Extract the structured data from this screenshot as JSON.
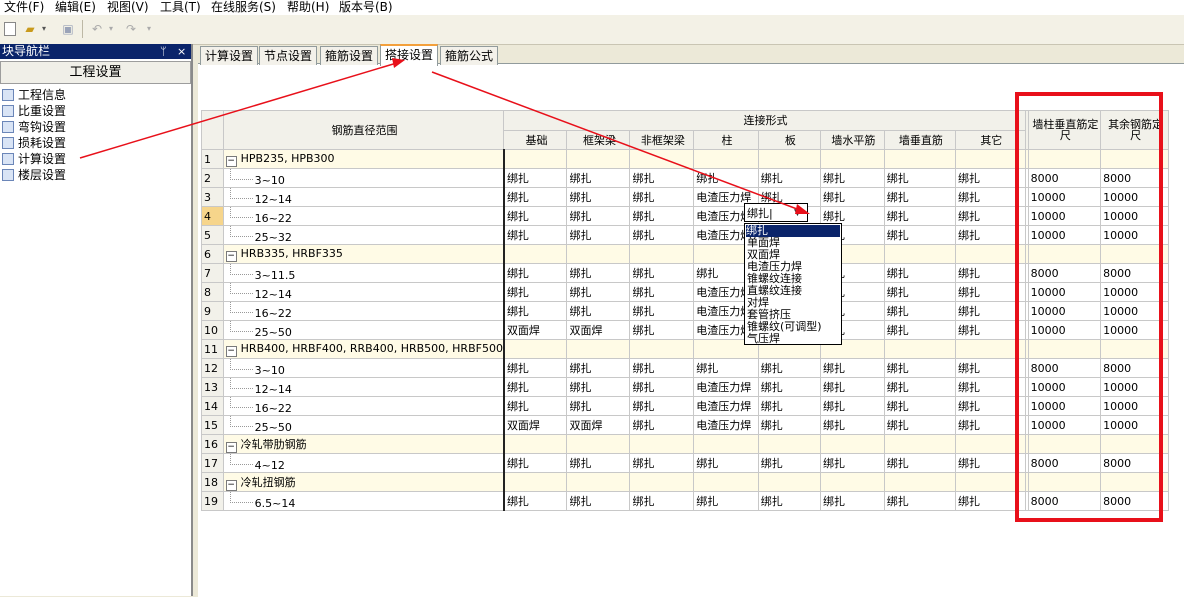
{
  "menu": [
    "文件(F)",
    "编辑(E)",
    "视图(V)",
    "工具(T)",
    "在线服务(S)",
    "帮助(H)",
    "版本号(B)"
  ],
  "toolbar_icons": [
    "new-icon",
    "open-icon",
    "save-icon",
    "undo-icon",
    "redo-icon"
  ],
  "panel": {
    "title": "块导航栏",
    "pin": "ᛘ",
    "close": "×",
    "header": "工程设置",
    "items": [
      "工程信息",
      "比重设置",
      "弯钩设置",
      "损耗设置",
      "计算设置",
      "楼层设置"
    ]
  },
  "tabs": [
    "计算设置",
    "节点设置",
    "箍筋设置",
    "搭接设置",
    "箍筋公式"
  ],
  "active_tab": "搭接设置",
  "grid": {
    "range_header": "钢筋直径范围",
    "group_header": "连接形式",
    "columns": [
      "基础",
      "框架梁",
      "非框架梁",
      "柱",
      "板",
      "墙水平筋",
      "墙垂直筋",
      "其它"
    ],
    "extra_columns": [
      "墙柱垂直筋定尺",
      "其余钢筋定尺"
    ],
    "rows": [
      {
        "num": "1",
        "label": "HPB235, HPB300",
        "group": true
      },
      {
        "num": "2",
        "label": "3~10",
        "cells": [
          "绑扎",
          "绑扎",
          "绑扎",
          "绑扎",
          "绑扎",
          "绑扎",
          "绑扎",
          "绑扎"
        ],
        "ext": [
          "8000",
          "8000"
        ]
      },
      {
        "num": "3",
        "label": "12~14",
        "cells": [
          "绑扎",
          "绑扎",
          "绑扎",
          "电渣压力焊",
          "绑扎",
          "绑扎",
          "绑扎",
          "绑扎"
        ],
        "ext": [
          "10000",
          "10000"
        ]
      },
      {
        "num": "4",
        "label": "16~22",
        "cells": [
          "绑扎",
          "绑扎",
          "绑扎",
          "电渣压力焊",
          "",
          "绑扎",
          "绑扎",
          "绑扎"
        ],
        "ext": [
          "10000",
          "10000"
        ]
      },
      {
        "num": "5",
        "label": "25~32",
        "cells": [
          "绑扎",
          "绑扎",
          "绑扎",
          "电渣压力焊",
          "",
          "绑扎",
          "绑扎",
          "绑扎"
        ],
        "ext": [
          "10000",
          "10000"
        ]
      },
      {
        "num": "6",
        "label": "HRB335, HRBF335",
        "group": true
      },
      {
        "num": "7",
        "label": "3~11.5",
        "cells": [
          "绑扎",
          "绑扎",
          "绑扎",
          "绑扎",
          "",
          "绑扎",
          "绑扎",
          "绑扎"
        ],
        "ext": [
          "8000",
          "8000"
        ]
      },
      {
        "num": "8",
        "label": "12~14",
        "cells": [
          "绑扎",
          "绑扎",
          "绑扎",
          "电渣压力焊",
          "",
          "绑扎",
          "绑扎",
          "绑扎"
        ],
        "ext": [
          "10000",
          "10000"
        ]
      },
      {
        "num": "9",
        "label": "16~22",
        "cells": [
          "绑扎",
          "绑扎",
          "绑扎",
          "电渣压力焊",
          "",
          "绑扎",
          "绑扎",
          "绑扎"
        ],
        "ext": [
          "10000",
          "10000"
        ]
      },
      {
        "num": "10",
        "label": "25~50",
        "cells": [
          "双面焊",
          "双面焊",
          "绑扎",
          "电渣压力焊",
          "",
          "绑扎",
          "绑扎",
          "绑扎"
        ],
        "ext": [
          "10000",
          "10000"
        ]
      },
      {
        "num": "11",
        "label": "HRB400, HRBF400, RRB400, HRB500, HRBF500",
        "group": true
      },
      {
        "num": "12",
        "label": "3~10",
        "cells": [
          "绑扎",
          "绑扎",
          "绑扎",
          "绑扎",
          "绑扎",
          "绑扎",
          "绑扎",
          "绑扎"
        ],
        "ext": [
          "8000",
          "8000"
        ]
      },
      {
        "num": "13",
        "label": "12~14",
        "cells": [
          "绑扎",
          "绑扎",
          "绑扎",
          "电渣压力焊",
          "绑扎",
          "绑扎",
          "绑扎",
          "绑扎"
        ],
        "ext": [
          "10000",
          "10000"
        ]
      },
      {
        "num": "14",
        "label": "16~22",
        "cells": [
          "绑扎",
          "绑扎",
          "绑扎",
          "电渣压力焊",
          "绑扎",
          "绑扎",
          "绑扎",
          "绑扎"
        ],
        "ext": [
          "10000",
          "10000"
        ]
      },
      {
        "num": "15",
        "label": "25~50",
        "cells": [
          "双面焊",
          "双面焊",
          "绑扎",
          "电渣压力焊",
          "绑扎",
          "绑扎",
          "绑扎",
          "绑扎"
        ],
        "ext": [
          "10000",
          "10000"
        ]
      },
      {
        "num": "16",
        "label": "冷轧带肋钢筋",
        "group": true
      },
      {
        "num": "17",
        "label": "4~12",
        "cells": [
          "绑扎",
          "绑扎",
          "绑扎",
          "绑扎",
          "绑扎",
          "绑扎",
          "绑扎",
          "绑扎"
        ],
        "ext": [
          "8000",
          "8000"
        ]
      },
      {
        "num": "18",
        "label": "冷轧扭钢筋",
        "group": true
      },
      {
        "num": "19",
        "label": "6.5~14",
        "cells": [
          "绑扎",
          "绑扎",
          "绑扎",
          "绑扎",
          "绑扎",
          "绑扎",
          "绑扎",
          "绑扎"
        ],
        "ext": [
          "8000",
          "8000"
        ]
      }
    ]
  },
  "editor": {
    "value": "绑扎",
    "caret": "|"
  },
  "dropdown_options": [
    "绑扎",
    "单面焊",
    "双面焊",
    "电渣压力焊",
    "锥螺纹连接",
    "直螺纹连接",
    "对焊",
    "套管挤压",
    "锥螺纹(可调型)",
    "气压焊"
  ],
  "colors": {
    "title_bar": "#0a246a",
    "annotation_red": "#e8101a",
    "active_tab_accent": "#f3a03b",
    "selected_header": "#f6d58b"
  }
}
